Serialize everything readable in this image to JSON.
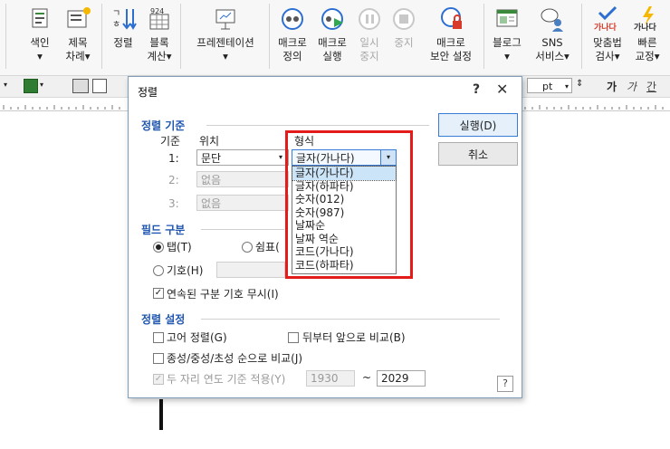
{
  "ribbon": {
    "items": [
      {
        "label": "색인\n▾"
      },
      {
        "label": "제목\n차례▾"
      },
      {
        "label": "정렬"
      },
      {
        "label": "블록\n계산▾"
      },
      {
        "label": "프레젠테이션\n▾"
      },
      {
        "label": "매크로\n정의"
      },
      {
        "label": "매크로\n실행"
      },
      {
        "label": "일시\n중지"
      },
      {
        "label": "중지"
      },
      {
        "label": "매크로\n보안 설정"
      },
      {
        "label": "블로그\n▾"
      },
      {
        "label": "SNS\n서비스▾"
      },
      {
        "label": "맞춤법\n검사▾"
      },
      {
        "label": "빠른\n교정▾"
      }
    ],
    "icon_text_calc": "924",
    "icon_text_spell": "가나다"
  },
  "toolbar": {
    "unit": "pt",
    "font_styles": [
      "가",
      "가",
      "간"
    ]
  },
  "dialog": {
    "title": "정렬",
    "help": "?",
    "close": "✕",
    "run_label": "실행(D)",
    "cancel_label": "취소",
    "criteria_section": "정렬 기준",
    "col_criteria": "기준",
    "col_position": "위치",
    "col_format": "형식",
    "rows": [
      {
        "num": "1:",
        "position": "문단",
        "format": "글자(가나다)"
      },
      {
        "num": "2:",
        "position": "없음"
      },
      {
        "num": "3:",
        "position": "없음"
      }
    ],
    "format_options": [
      "글자(가나다)",
      "글자(하파타)",
      "숫자(012)",
      "숫자(987)",
      "날짜순",
      "날짜 역순",
      "코드(가나다)",
      "코드(하파타)"
    ],
    "field_section": "필드 구분",
    "tab_label": "탭(T)",
    "comma_label": "쉼표(",
    "symbol_label": "기호(H)",
    "ignore_consecutive": "연속된 구분 기호 무시(I)",
    "settings_section": "정렬 설정",
    "unique_sort": "고어 정렬(G)",
    "reverse_compare": "뒤부터 앞으로 비교(B)",
    "jamo_compare": "종성/중성/초성 순으로 비교(J)",
    "two_digit_year": "두 자리 연도 기준 적용(Y)",
    "year_from": "1930",
    "tilde": "~",
    "year_to": "2029"
  }
}
